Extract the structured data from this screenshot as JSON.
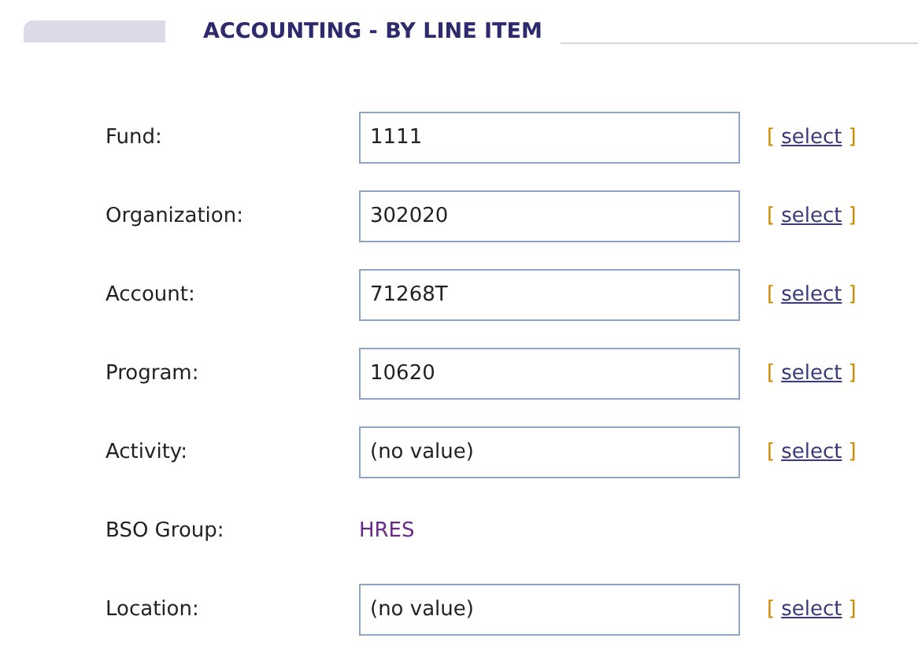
{
  "header": {
    "title": "ACCOUNTING - BY LINE ITEM"
  },
  "rows": [
    {
      "kind": "field",
      "label": "Fund:",
      "value": "1111",
      "action": {
        "open": "[",
        "link": "select",
        "close": "]"
      }
    },
    {
      "kind": "field",
      "label": "Organization:",
      "value": "302020",
      "action": {
        "open": "[",
        "link": "select",
        "close": "]"
      }
    },
    {
      "kind": "field",
      "label": "Account:",
      "value": "71268T",
      "action": {
        "open": "[",
        "link": "select",
        "close": "]"
      }
    },
    {
      "kind": "field",
      "label": "Program:",
      "value": "10620",
      "action": {
        "open": "[",
        "link": "select",
        "close": "]"
      }
    },
    {
      "kind": "field",
      "label": "Activity:",
      "value": "(no value)",
      "action": {
        "open": "[",
        "link": "select",
        "close": "]"
      }
    },
    {
      "kind": "text",
      "label": "BSO Group:",
      "value": "HRES"
    },
    {
      "kind": "field",
      "label": "Location:",
      "value": "(no value)",
      "action": {
        "open": "[",
        "link": "select",
        "close": "]"
      }
    }
  ]
}
